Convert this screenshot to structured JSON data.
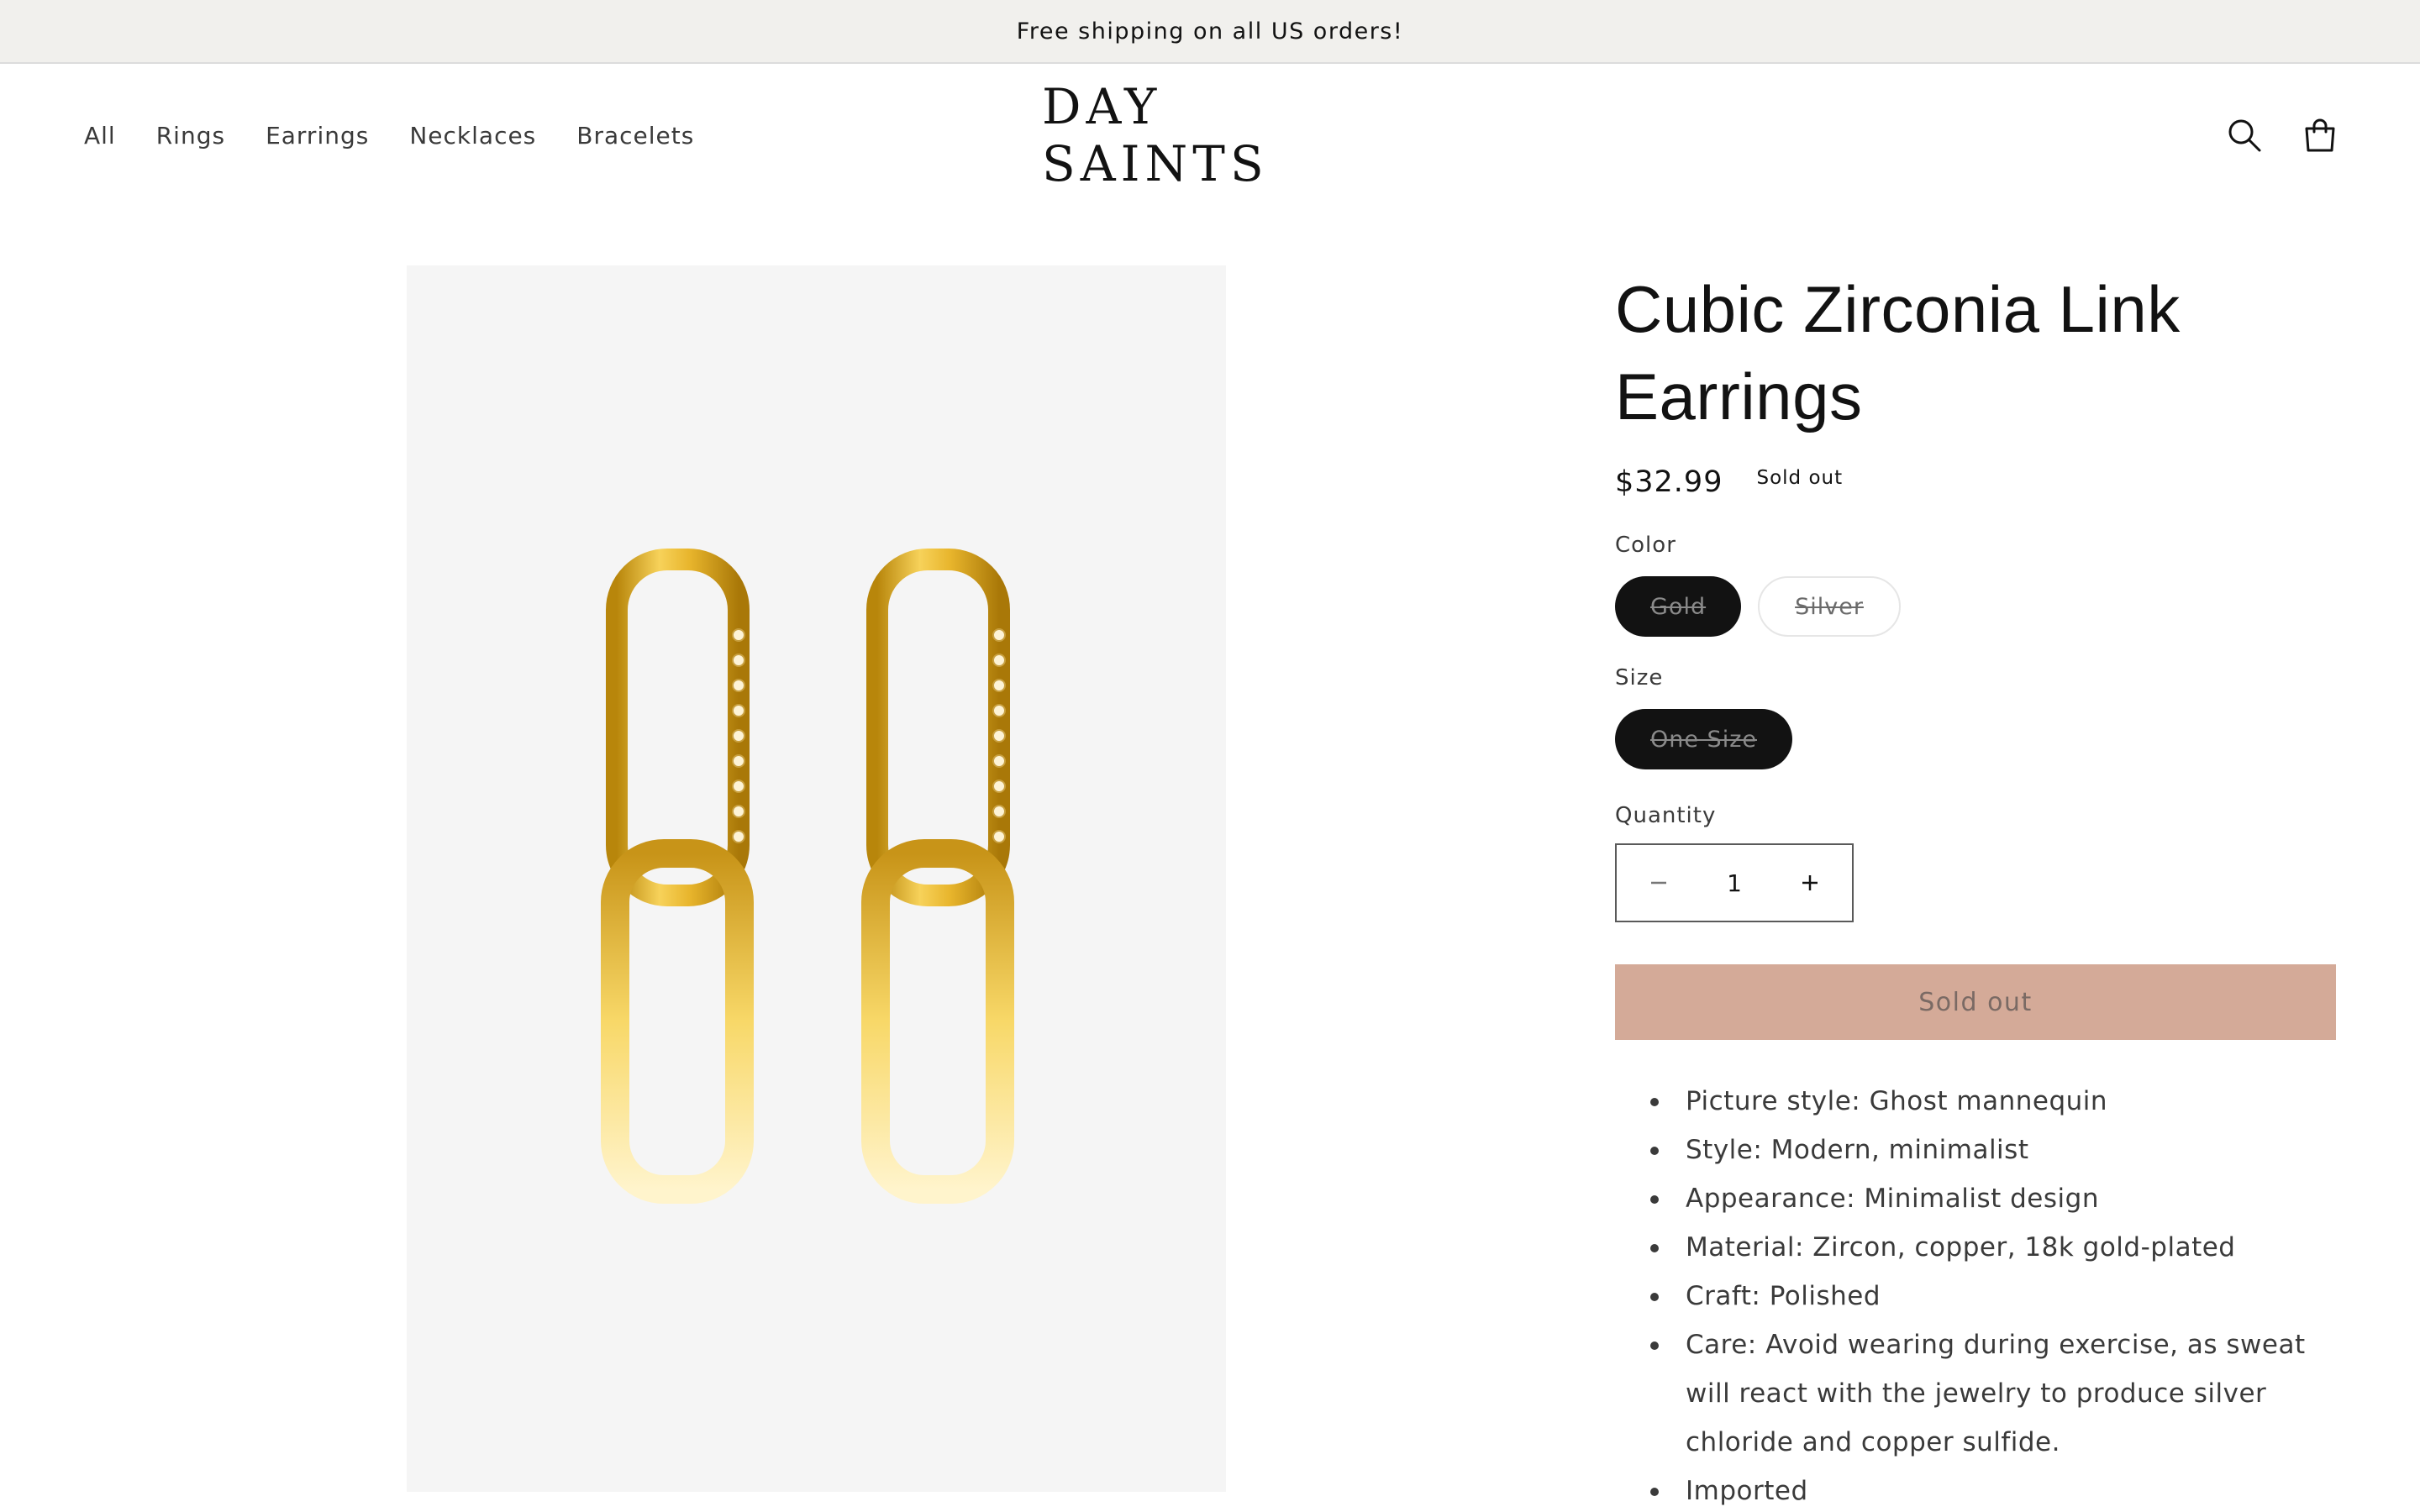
{
  "announcement": {
    "text": "Free shipping on all US orders!"
  },
  "header": {
    "nav": [
      "All",
      "Rings",
      "Earrings",
      "Necklaces",
      "Bracelets"
    ],
    "logo": "DAY SAINTS",
    "icons": [
      "search-icon",
      "cart-icon"
    ]
  },
  "product": {
    "title_line1": "Cubic Zirconia Link",
    "title_line2": "Earrings",
    "price": "$32.99",
    "badge": "Sold out",
    "color_label": "Color",
    "colors": [
      "Gold",
      "Silver"
    ],
    "selected_color": "Gold",
    "size_label": "Size",
    "sizes": [
      "One Size"
    ],
    "quantity_label": "Quantity",
    "quantity": "1",
    "button_label": "Sold out",
    "features": [
      "Picture style: Ghost mannequin",
      "Style: Modern, minimalist",
      "Appearance: Minimalist design",
      "Material: Zircon, copper, 18k gold-plated",
      "Craft: Polished",
      "Care: Avoid wearing during exercise, as sweat will react with the jewelry to produce silver chloride and copper sulfide.",
      "Imported"
    ]
  },
  "colors": {
    "announcement_bg": "#f1f0ed",
    "button_bg": "#d4aa98",
    "selected_pill": "#121212",
    "media_bg": "#f5f5f5"
  }
}
